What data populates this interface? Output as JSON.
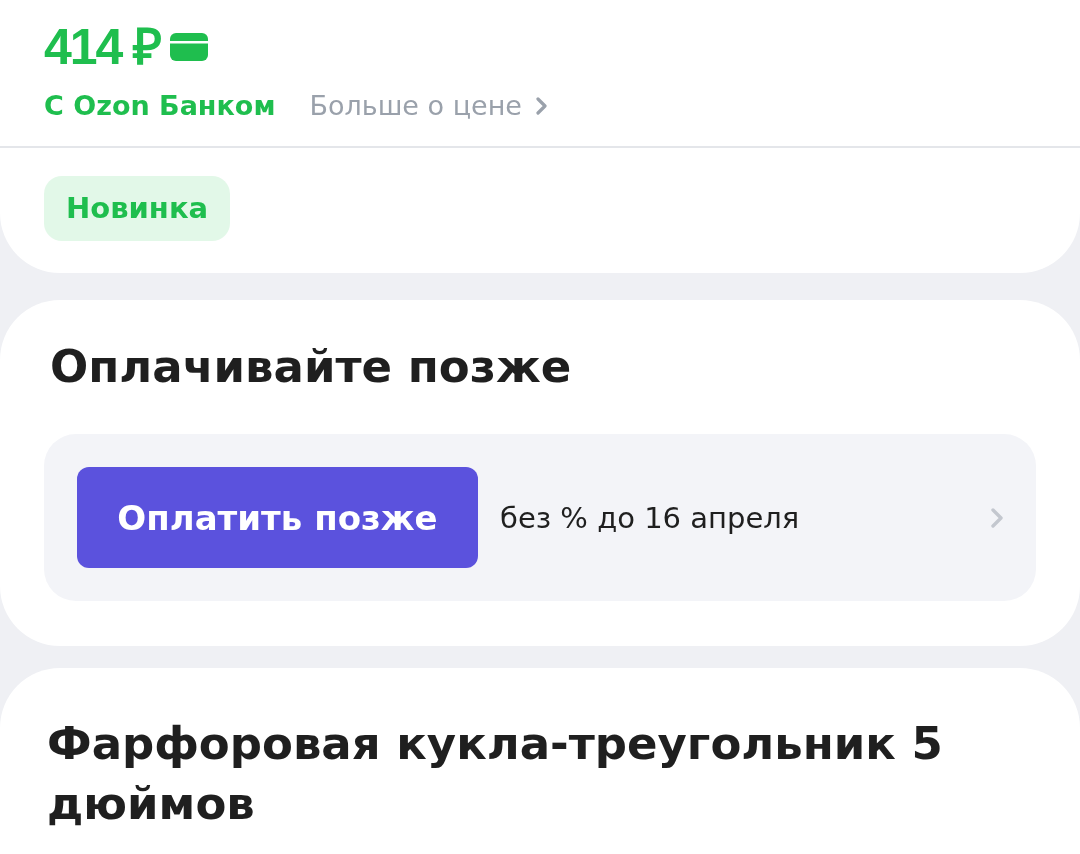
{
  "price_header": {
    "price": "414 ₽",
    "price_note": "С Ozon Банком",
    "more_link": "Больше о цене"
  },
  "badge": {
    "label": "Новинка"
  },
  "pay_later": {
    "title": "Оплачивайте позже",
    "button": "Оплатить позже",
    "terms": "без % до 16 апреля"
  },
  "product": {
    "title": "Фарфоровая кукла-треугольник 5 дюймов"
  }
}
